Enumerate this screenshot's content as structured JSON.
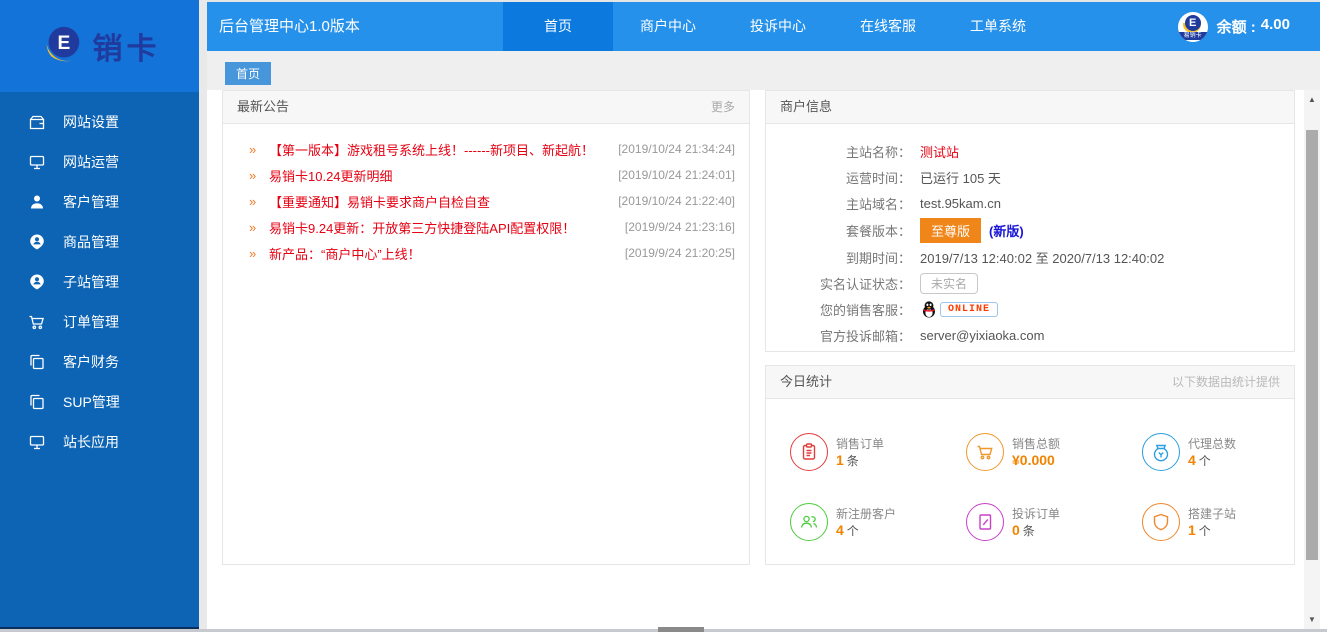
{
  "page": {
    "title": "后台管理中心1.0版本"
  },
  "brand": {
    "name": "销卡",
    "logo_letter": "E",
    "avatar_caption": "易销卡"
  },
  "topnav": {
    "items": [
      {
        "label": "首页",
        "active": true
      },
      {
        "label": "商户中心",
        "active": false
      },
      {
        "label": "投诉中心",
        "active": false
      },
      {
        "label": "在线客服",
        "active": false
      },
      {
        "label": "工单系统",
        "active": false
      }
    ],
    "balance_label": "余额 :",
    "balance_value": "4.00"
  },
  "breadcrumb": {
    "tab": "首页"
  },
  "sidebar": {
    "items": [
      {
        "icon": "wallet-icon",
        "label": "网站设置"
      },
      {
        "icon": "monitor-icon",
        "label": "网站运营"
      },
      {
        "icon": "user-icon",
        "label": "客户管理"
      },
      {
        "icon": "user-pin-icon",
        "label": "商品管理"
      },
      {
        "icon": "user-pin-icon",
        "label": "子站管理"
      },
      {
        "icon": "cart-icon",
        "label": "订单管理"
      },
      {
        "icon": "copy-icon",
        "label": "客户财务"
      },
      {
        "icon": "copy-icon",
        "label": "SUP管理"
      },
      {
        "icon": "monitor-icon",
        "label": "站长应用"
      }
    ]
  },
  "announcements": {
    "title": "最新公告",
    "more_label": "更多",
    "items": [
      {
        "title": "【第一版本】游戏租号系统上线！------新项目、新起航！",
        "date": "[2019/10/24 21:34:24]"
      },
      {
        "title": "易销卡10.24更新明细",
        "date": "[2019/10/24 21:24:01]"
      },
      {
        "title": "【重要通知】易销卡要求商户自检自查",
        "date": "[2019/10/24 21:22:40]"
      },
      {
        "title": "易销卡9.24更新：开放第三方快捷登陆API配置权限！",
        "date": "[2019/9/24 21:23:16]"
      },
      {
        "title": "新产品：“商户中心”上线！",
        "date": "[2019/9/24 21:20:25]"
      }
    ]
  },
  "merchant": {
    "title": "商户信息",
    "rows": [
      {
        "label": "主站名称：",
        "value": "测试站"
      },
      {
        "label": "运营时间：",
        "value": "已运行 105 天"
      },
      {
        "label": "主站域名：",
        "value": "test.95kam.cn"
      },
      {
        "label": "套餐版本：",
        "badge": "至尊版",
        "extra": "(新版)"
      },
      {
        "label": "到期时间：",
        "value": "2019/7/13 12:40:02 至 2020/7/13 12:40:02"
      },
      {
        "label": "实名认证状态：",
        "value": "未实名"
      },
      {
        "label": "您的销售客服：",
        "value": "ONLINE"
      },
      {
        "label": "官方投诉邮箱：",
        "value": "server@yixiaoka.com"
      }
    ]
  },
  "stats": {
    "title": "今日统计",
    "subtitle": "以下数据由统计提供",
    "cards": [
      {
        "label": "销售订单",
        "value": "1",
        "unit": "条",
        "icon": "clipboard-icon",
        "color": "#e23d3d"
      },
      {
        "label": "销售总额",
        "value": "¥0.000",
        "unit": "",
        "icon": "cart-icon",
        "color": "#f0982e"
      },
      {
        "label": "代理总数",
        "value": "4",
        "unit": "个",
        "icon": "moneybag-icon",
        "color": "#2e9fe0"
      },
      {
        "label": "新注册客户",
        "value": "4",
        "unit": "个",
        "icon": "users-icon",
        "color": "#4ecb3c"
      },
      {
        "label": "投诉订单",
        "value": "0",
        "unit": "条",
        "icon": "document-edit-icon",
        "color": "#c840c8"
      },
      {
        "label": "搭建子站",
        "value": "1",
        "unit": "个",
        "icon": "shield-icon",
        "color": "#f0882e"
      }
    ]
  },
  "colors": {
    "topbar_blue": "#2591ea",
    "active_nav_blue": "#0b79dd",
    "sidebar_blue": "#0d64b5",
    "logo_block_blue": "#1373d8",
    "brand_navy": "#203a9e",
    "brand_yellow": "#f6c02d",
    "announcement_red": "#e60012",
    "accent_orange": "#f08300",
    "badge_orange": "#f08519",
    "new_version_blue": "#1a16d8",
    "online_text": "#ff3c00"
  }
}
